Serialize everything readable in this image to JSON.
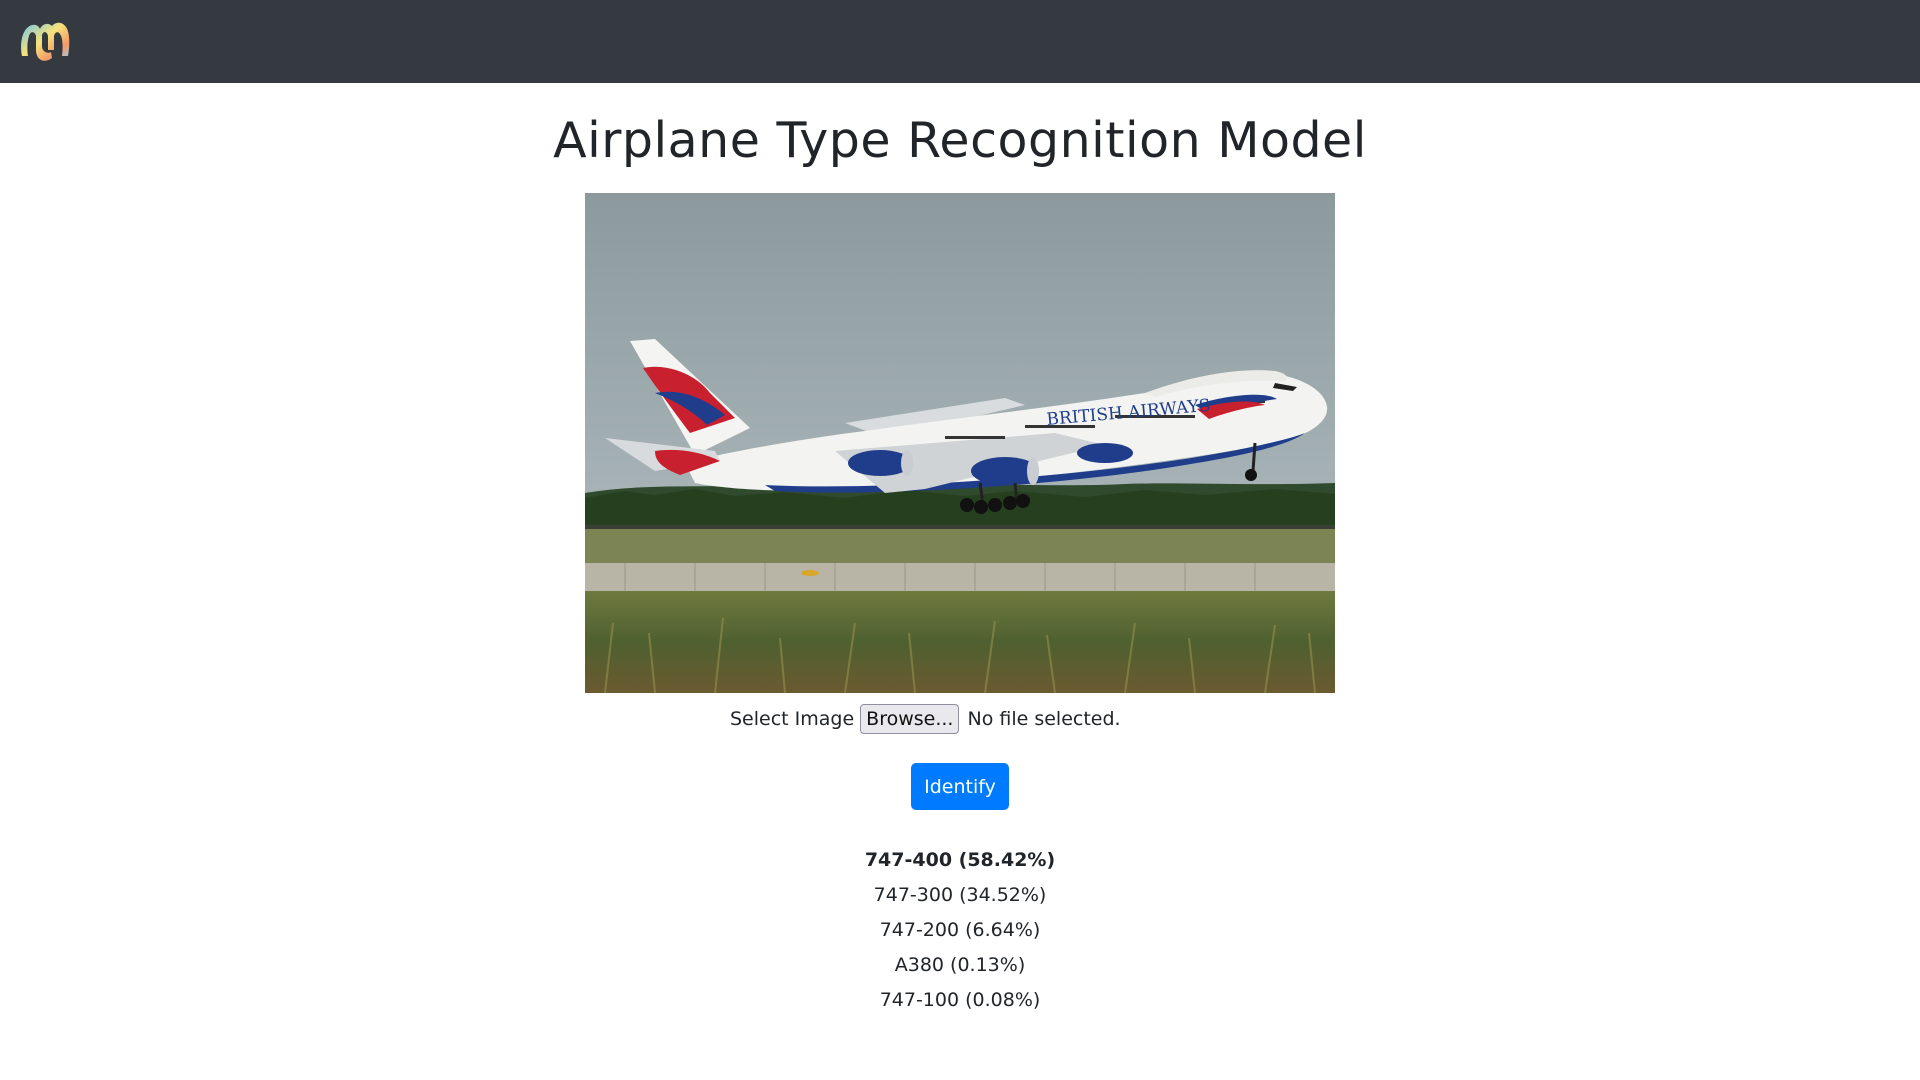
{
  "header": {
    "logo_icon": "brain-logo-icon",
    "background": "#343a40"
  },
  "page": {
    "title": "Airplane Type Recognition Model"
  },
  "image": {
    "description_icon": "airplane-photo",
    "livery_text": "BRITISH AIRWAYS"
  },
  "upload": {
    "label": "Select Image",
    "browse_label": "Browse...",
    "status": "No file selected."
  },
  "actions": {
    "identify_label": "Identify",
    "identify_color": "#007bff"
  },
  "results": [
    {
      "label": "747-400 (58.42%)",
      "top": true
    },
    {
      "label": "747-300 (34.52%)",
      "top": false
    },
    {
      "label": "747-200 (6.64%)",
      "top": false
    },
    {
      "label": "A380 (0.13%)",
      "top": false
    },
    {
      "label": "747-100 (0.08%)",
      "top": false
    }
  ]
}
